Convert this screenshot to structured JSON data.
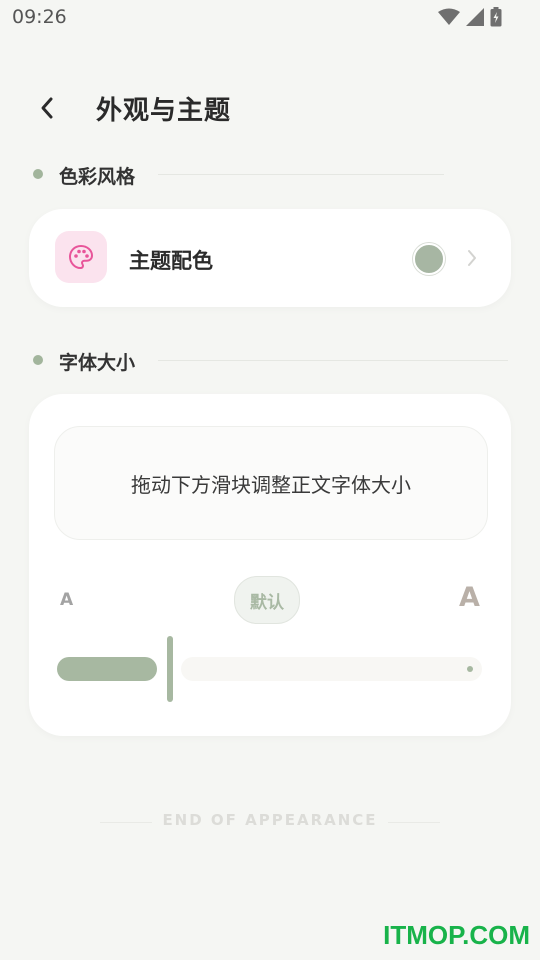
{
  "status": {
    "time": "09:26"
  },
  "header": {
    "title": "外观与主题"
  },
  "sections": {
    "color_style": {
      "label": "色彩风格"
    },
    "font_size": {
      "label": "字体大小"
    }
  },
  "theme": {
    "label": "主题配色",
    "selected_color": "#a7b6a3"
  },
  "font": {
    "preview_text": "拖动下方滑块调整正文字体大小",
    "small_label": "A",
    "large_label": "A",
    "default_label": "默认",
    "level": 0.2
  },
  "footer": {
    "end_text": "END OF APPEARANCE"
  },
  "watermark": "ITMOP.COM",
  "colors": {
    "accent": "#a7b8a1",
    "palette_icon": "#e8559a",
    "palette_bg": "#fbe3ee"
  }
}
